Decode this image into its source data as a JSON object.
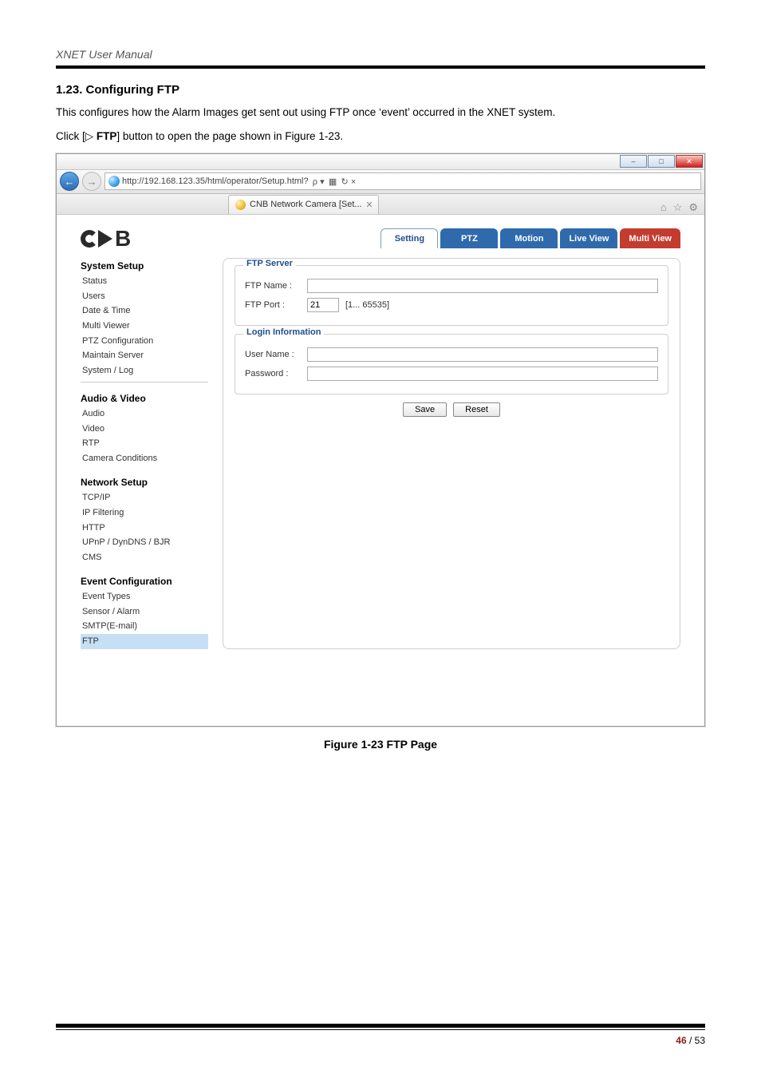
{
  "doc": {
    "manual_title": "XNET User Manual",
    "heading": "1.23. Configuring FTP",
    "para1": "This configures how the Alarm Images get sent out using FTP once ‘event’ occurred in the XNET system.",
    "para2_prefix": "Click [",
    "para2_icon": "▷ ",
    "para2_bold": "FTP",
    "para2_suffix": "] button to open the page shown in Figure 1-23.",
    "figure_caption": "Figure 1-23 FTP Page",
    "page_current": "46",
    "page_sep": " / ",
    "page_total": "53"
  },
  "browser": {
    "url_text": "http://192.168.123.35/html/operator/Setup.html?",
    "url_suffix": "  ρ ▾  ▦  ↻ ×",
    "tab_title": "CNB Network Camera [Set...",
    "win_min": "–",
    "win_max": "□",
    "win_close": "✕",
    "tool_home": "⌂",
    "tool_star": "☆",
    "tool_gear": "⚙"
  },
  "app": {
    "logo_text": "CNB",
    "tabs": {
      "setting": "Setting",
      "ptz": "PTZ",
      "motion": "Motion",
      "live": "Live View",
      "multi": "Multi View"
    },
    "sidebar": {
      "g1": "System Setup",
      "g1items": [
        "Status",
        "Users",
        "Date & Time",
        "Multi Viewer",
        "PTZ Configuration",
        "Maintain Server",
        "System / Log"
      ],
      "g2": "Audio & Video",
      "g2items": [
        "Audio",
        "Video",
        "RTP",
        "Camera Conditions"
      ],
      "g3": "Network Setup",
      "g3items": [
        "TCP/IP",
        "IP Filtering",
        "HTTP",
        "UPnP / DynDNS / BJR",
        "CMS"
      ],
      "g4": "Event Configuration",
      "g4items": [
        "Event Types",
        "Sensor / Alarm",
        "SMTP(E-mail)",
        "FTP"
      ]
    },
    "form": {
      "legend1": "FTP Server",
      "ftp_name_label": "FTP Name :",
      "ftp_name_value": "",
      "ftp_port_label": "FTP Port :",
      "ftp_port_value": "21",
      "ftp_port_hint": "[1... 65535]",
      "legend2": "Login Information",
      "user_label": "User Name :",
      "user_value": "",
      "pass_label": "Password :",
      "pass_value": "",
      "save_btn": "Save",
      "reset_btn": "Reset"
    }
  }
}
